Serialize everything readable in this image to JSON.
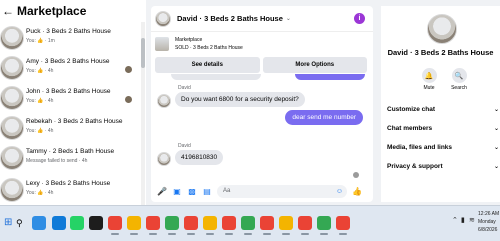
{
  "left": {
    "back_icon": "arrow-left",
    "title": "Marketplace",
    "conversations": [
      {
        "title": "Puck · 3 Beds 2 Baths House",
        "you": "You:",
        "like": "👍",
        "time": "· 1m",
        "badge": false
      },
      {
        "title": "Amy · 3 Beds 2 Baths House",
        "you": "You:",
        "like": "👍",
        "time": "· 4h",
        "badge": true
      },
      {
        "title": "John · 3 Beds 2 Baths House",
        "you": "You:",
        "like": "👍",
        "time": "· 4h",
        "badge": true
      },
      {
        "title": "Rebekah · 3 Beds 2 Baths House",
        "you": "You:",
        "like": "👍",
        "time": "· 4h",
        "badge": false
      },
      {
        "title": "Tammy · 2 Beds 1 Bath House",
        "you": "",
        "like": "",
        "time": "Message failed to send · 4h",
        "badge": false
      },
      {
        "title": "Lexy · 3 Beds 2 Baths House",
        "you": "You:",
        "like": "👍",
        "time": "· 4h",
        "badge": false
      }
    ]
  },
  "chat": {
    "title": "David · 3 Beds 2 Baths House",
    "info_icon": "info-icon",
    "listing_line1": "Marketplace",
    "listing_line2": "SOLD · 3 Beds 2 Baths House",
    "see_details": "See details",
    "more_options": "More Options",
    "messages": [
      {
        "sender": "David",
        "text": "Do you want 6800 for a security deposit?"
      },
      {
        "own": true,
        "text": "dear send me number"
      },
      {
        "sender": "David",
        "text": "4196810830"
      }
    ],
    "composer_placeholder": "Aa"
  },
  "right": {
    "name": "David · 3 Beds 2 Baths House",
    "mute": "Mute",
    "search": "Search",
    "menu": [
      "Customize chat",
      "Chat members",
      "Media, files and links",
      "Privacy & support"
    ]
  },
  "taskbar": {
    "time": "12:26 AM",
    "day": "Monday",
    "date": "6/8/2026"
  },
  "colors": {
    "accent": "#7a6cf0",
    "info_purple": "#9b36d6",
    "link_blue": "#1877f2"
  }
}
